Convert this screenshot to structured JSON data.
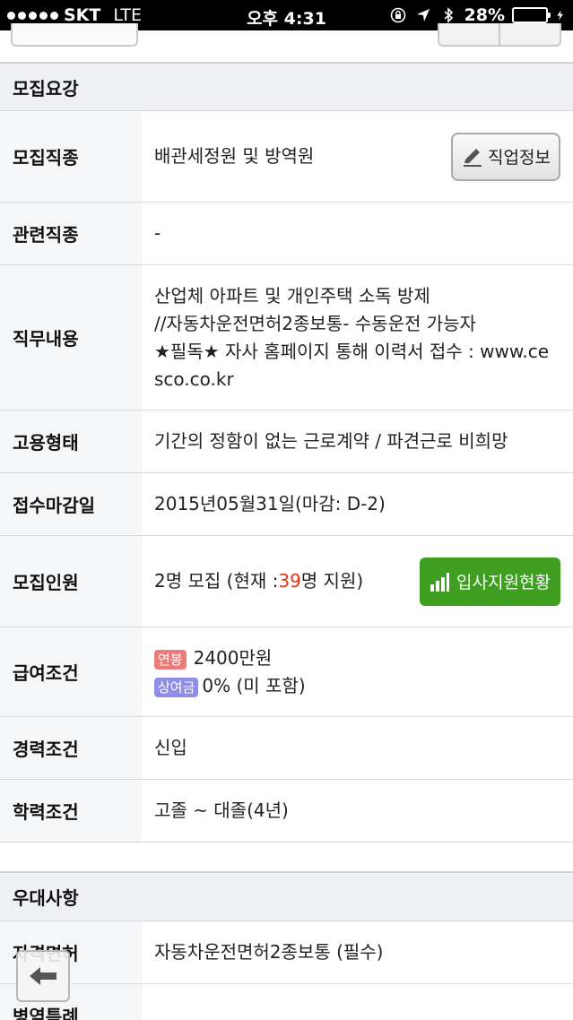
{
  "status_bar": {
    "carrier": "SKT",
    "network": "LTE",
    "time": "오후 4:31",
    "battery_percent": "28%",
    "battery_level": 0.28
  },
  "sections": {
    "recruit": {
      "title": "모집요강"
    },
    "preference": {
      "title": "우대사항"
    }
  },
  "rows": {
    "job_type": {
      "label": "모집직종",
      "value": "배관세정원 및 방역원",
      "button": "직업정보"
    },
    "related": {
      "label": "관련직종",
      "value": "-"
    },
    "duties": {
      "label": "직무내용",
      "lines": [
        "산업체 아파트 및 개인주택 소독 방제",
        "//자동차운전면허2종보통- 수동운전 가능자",
        "★필독★ 자사 홈페이지 통해 이력서 접수 : www.ce",
        "sco.co.kr"
      ]
    },
    "employment": {
      "label": "고용형태",
      "value": "기간의 정함이 없는 근로계약 / 파견근로 비희망"
    },
    "deadline": {
      "label": "접수마감일",
      "value": "2015년05월31일(마감: D-2)"
    },
    "headcount": {
      "label": "모집인원",
      "prefix": "2명 모집 (현재 : ",
      "current": "39",
      "suffix": "명 지원)",
      "button": "입사지원현황"
    },
    "salary": {
      "label": "급여조건",
      "annual_badge": "연봉",
      "annual_value": "2400만원",
      "bonus_badge": "상여금",
      "bonus_value": "0% (미 포함)"
    },
    "experience": {
      "label": "경력조건",
      "value": "신입"
    },
    "education": {
      "label": "학력조건",
      "value": "고졸 ~ 대졸(4년)"
    },
    "license": {
      "label": "자격면허",
      "value": "자동차운전면허2종보통 (필수)"
    },
    "military": {
      "label": "병역특례",
      "value": ""
    }
  },
  "colors": {
    "apply_button": "#3e9e1f",
    "highlight": "#e2341b",
    "annual_badge": "#ec7b7b",
    "bonus_badge": "#8e8ee6"
  },
  "icons": {
    "job_info": "pencil-icon",
    "apply_status": "bar-chart-icon",
    "back": "back-arrow-icon"
  }
}
